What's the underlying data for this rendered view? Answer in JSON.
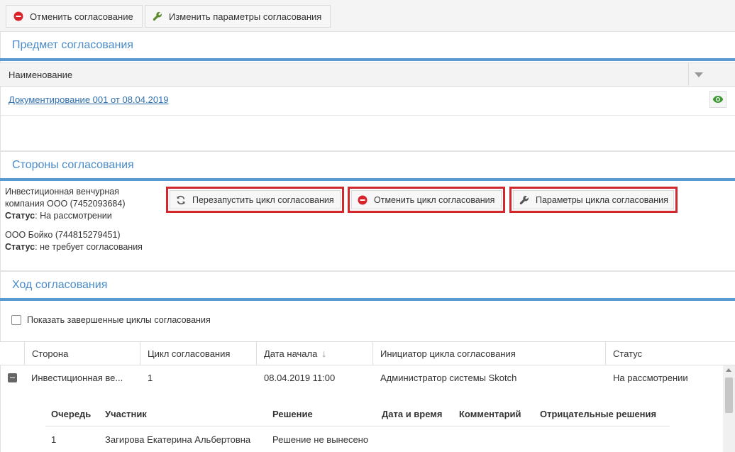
{
  "toolbar": {
    "cancel_label": "Отменить согласование",
    "change_params_label": "Изменить параметры согласования"
  },
  "subject": {
    "title": "Предмет согласования",
    "column_name": "Наименование",
    "document_link": "Документирование 001 от 08.04.2019"
  },
  "parties": {
    "title": "Стороны согласования",
    "items": [
      {
        "name_line1": "Инвестиционная венчурная",
        "name_line2": "компания ООО (7452093684)",
        "status_label": "Статус",
        "status_value": ": На рассмотрении"
      },
      {
        "name_line1": "ООО Бойко (744815279451)",
        "status_label": "Статус",
        "status_value": ": не требует согласования"
      }
    ],
    "buttons": {
      "restart": "Перезапустить цикл согласования",
      "cancel_cycle": "Отменить цикл согласования",
      "cycle_params": "Параметры цикла согласования"
    }
  },
  "progress": {
    "title": "Ход согласования",
    "show_completed_label": "Показать завершенные циклы согласования",
    "columns": [
      "Сторона",
      "Цикл согласования",
      "Дата начала",
      "Инициатор цикла согласования",
      "Статус"
    ],
    "row": {
      "party": "Инвестиционная ве...",
      "cycle": "1",
      "start_date": "08.04.2019 11:00",
      "initiator": "Администратор системы Skotch",
      "status": "На рассмотрении"
    },
    "sub_columns": [
      "Очередь",
      "Участник",
      "Решение",
      "Дата и время",
      "Комментарий",
      "Отрицательные решения"
    ],
    "sub_row": {
      "queue": "1",
      "participant": "Загирова Екатерина Альбертовна",
      "decision": "Решение не вынесено"
    }
  },
  "colors": {
    "accent": "#4a8bc7",
    "section_bar": "#5a9ad1",
    "highlight": "#d0282c",
    "link": "#2f6fad"
  }
}
